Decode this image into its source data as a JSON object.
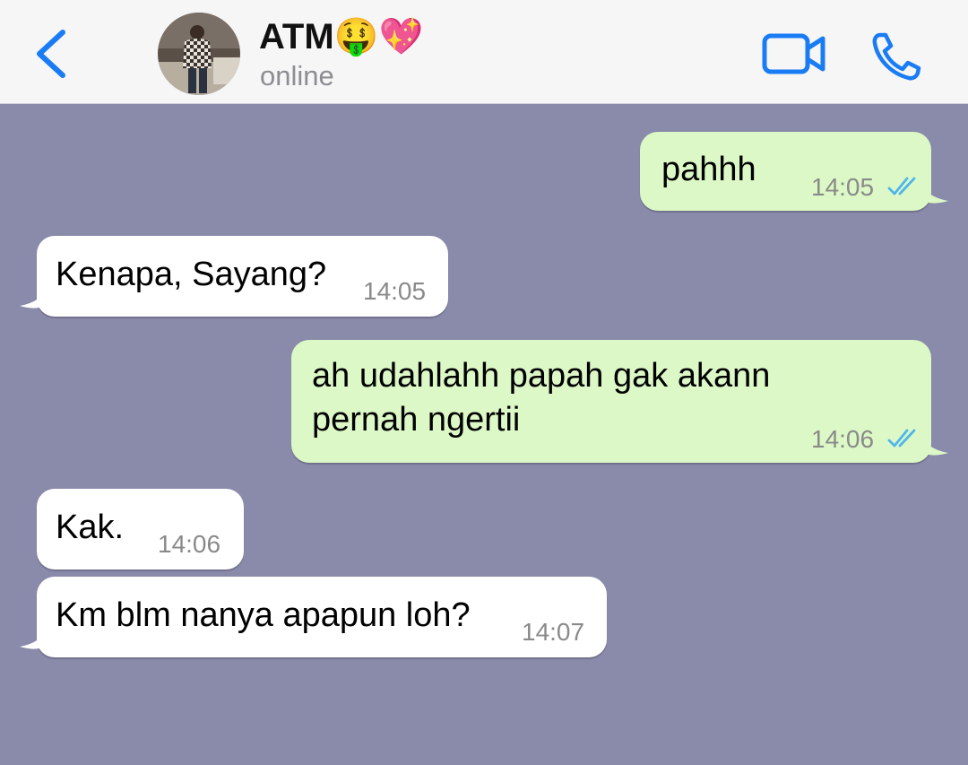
{
  "header": {
    "contact_name": "ATM🤑💖",
    "status": "online",
    "colors": {
      "accent": "#1a7cf5",
      "background": "#f6f6f6"
    }
  },
  "chat": {
    "background_color": "#8a8aab",
    "incoming_color": "#ffffff",
    "outgoing_color": "#dcf8c6",
    "tick_color": "#4fb6ec",
    "messages": [
      {
        "direction": "out",
        "lines": [
          "pahhh"
        ],
        "time": "14:05",
        "status": "read"
      },
      {
        "direction": "in",
        "lines": [
          "Kenapa, Sayang?"
        ],
        "time": "14:05"
      },
      {
        "direction": "out",
        "lines": [
          "ah udahlahh papah gak akann",
          "pernah ngertii"
        ],
        "time": "14:06",
        "status": "read"
      },
      {
        "direction": "in",
        "lines": [
          "Kak."
        ],
        "time": "14:06"
      },
      {
        "direction": "in",
        "lines": [
          "Km blm nanya apapun loh?"
        ],
        "time": "14:07"
      }
    ]
  }
}
